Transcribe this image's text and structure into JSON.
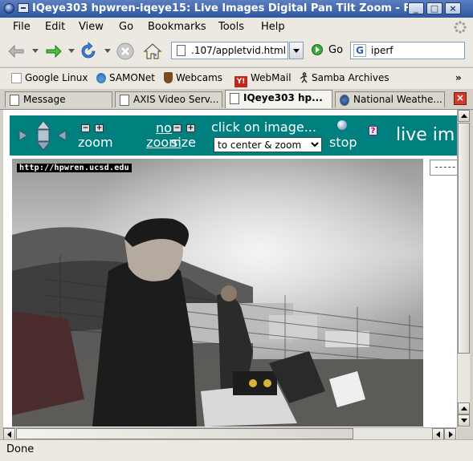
{
  "window": {
    "title": "IQeye303 hpwren-iqeye15: Live Images Digital Pan Tilt Zoom - F",
    "controls": {
      "minimize": "_",
      "maximize": "□",
      "close": "×"
    }
  },
  "menubar": {
    "items": [
      "File",
      "Edit",
      "View",
      "Go",
      "Bookmarks",
      "Tools",
      "Help"
    ]
  },
  "navbar": {
    "url": ".107/appletvid.html",
    "go_label": "Go",
    "search_value": "iperf",
    "search_engine_letter": "G"
  },
  "bookmarks": {
    "items": [
      {
        "label": "Google Linux",
        "icon": "google-icon"
      },
      {
        "label": "SAMONet",
        "icon": "drop-icon"
      },
      {
        "label": "Webcams",
        "icon": "badge-icon"
      },
      {
        "label": "WebMail",
        "icon": "yahoo-icon"
      },
      {
        "label": "Samba Archives",
        "icon": "dancer-icon"
      }
    ],
    "overflow": "»"
  },
  "tabs": [
    {
      "label": "Message",
      "active": false
    },
    {
      "label": "AXIS Video Serv...",
      "active": false
    },
    {
      "label": "IQeye303 hp...",
      "active": true
    },
    {
      "label": "National Weathe...",
      "active": false
    }
  ],
  "camera_controls": {
    "zoom_label": "zoom",
    "no_zoom_label": "no zoom",
    "size_label": "size",
    "click_prompt": "click on image...",
    "mode_select": "to center & zoom",
    "stop_label": "stop",
    "help_label": "?",
    "live_label": "live im",
    "colors": {
      "bar": "#007f7f",
      "text": "#ffffff"
    }
  },
  "video": {
    "overlay_text": "http://hpwren.ucsd.edu"
  },
  "status": {
    "text": "Done"
  }
}
